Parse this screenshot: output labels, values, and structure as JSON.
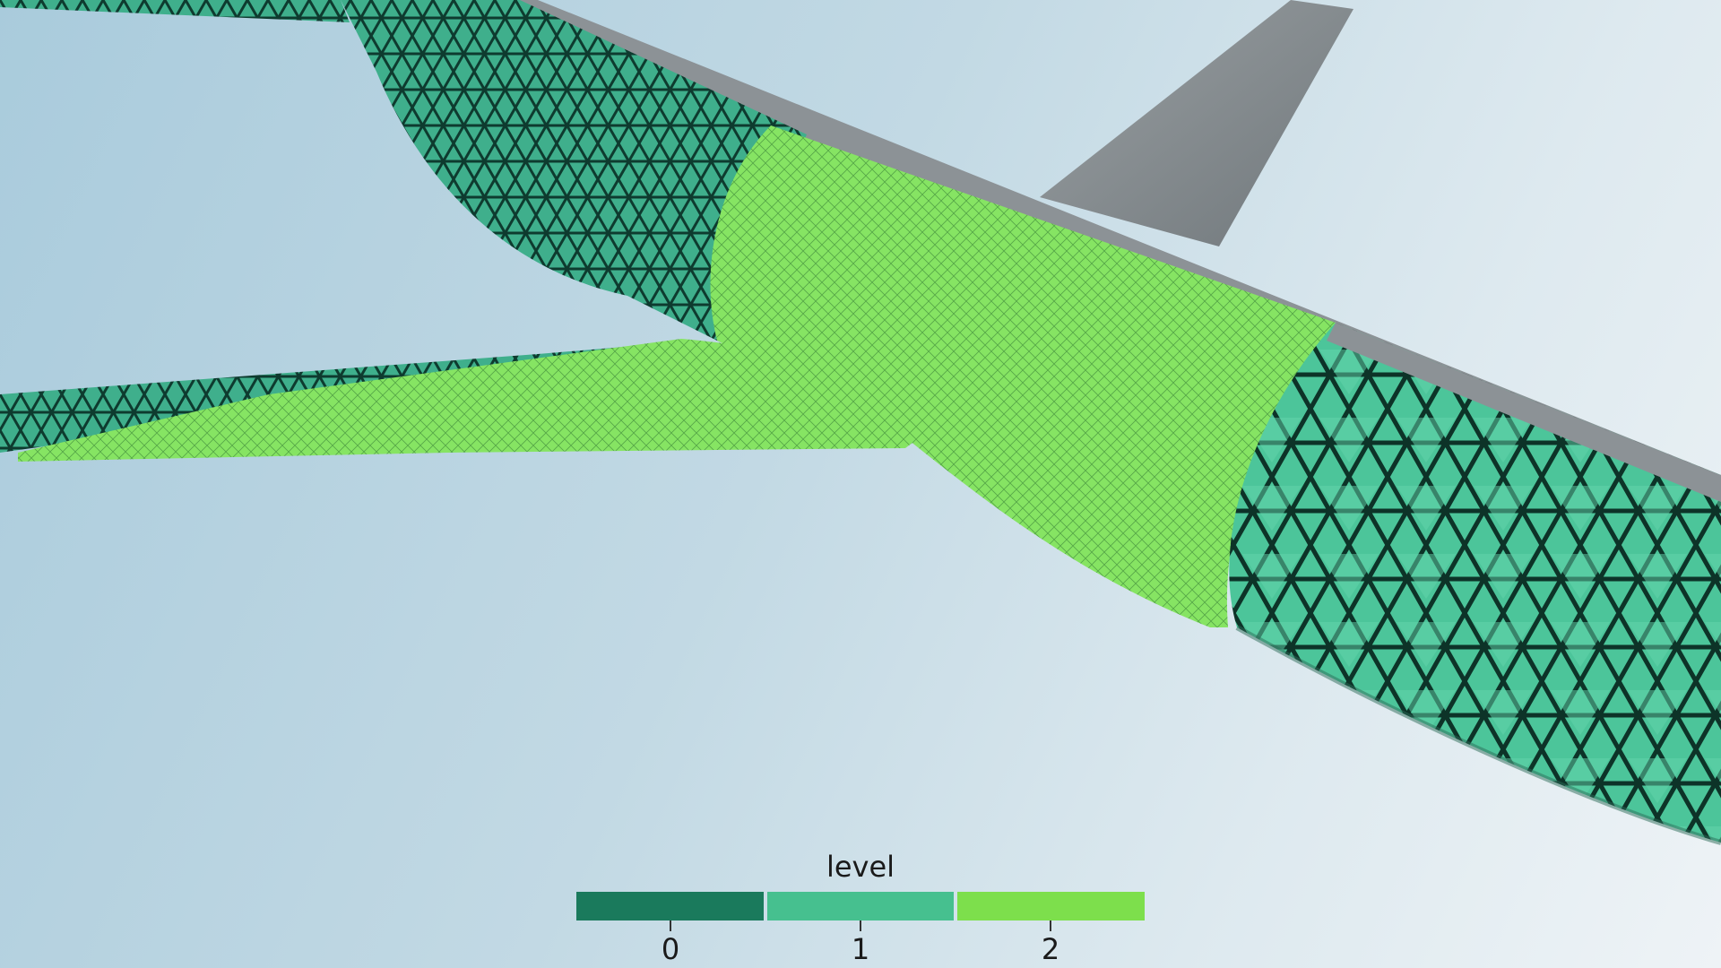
{
  "legend": {
    "title": "level",
    "levels": [
      {
        "label": "0",
        "color": "#1a7a5c"
      },
      {
        "label": "1",
        "color": "#46c08f"
      },
      {
        "label": "2",
        "color": "#7ddf4c"
      }
    ]
  },
  "palette": {
    "body_dark": "#2e9a7c",
    "body_mid": "#4cc59a",
    "refined_green": "#8be868",
    "tail_gray": "#8c9296",
    "mesh_line": "#0d3d30"
  }
}
